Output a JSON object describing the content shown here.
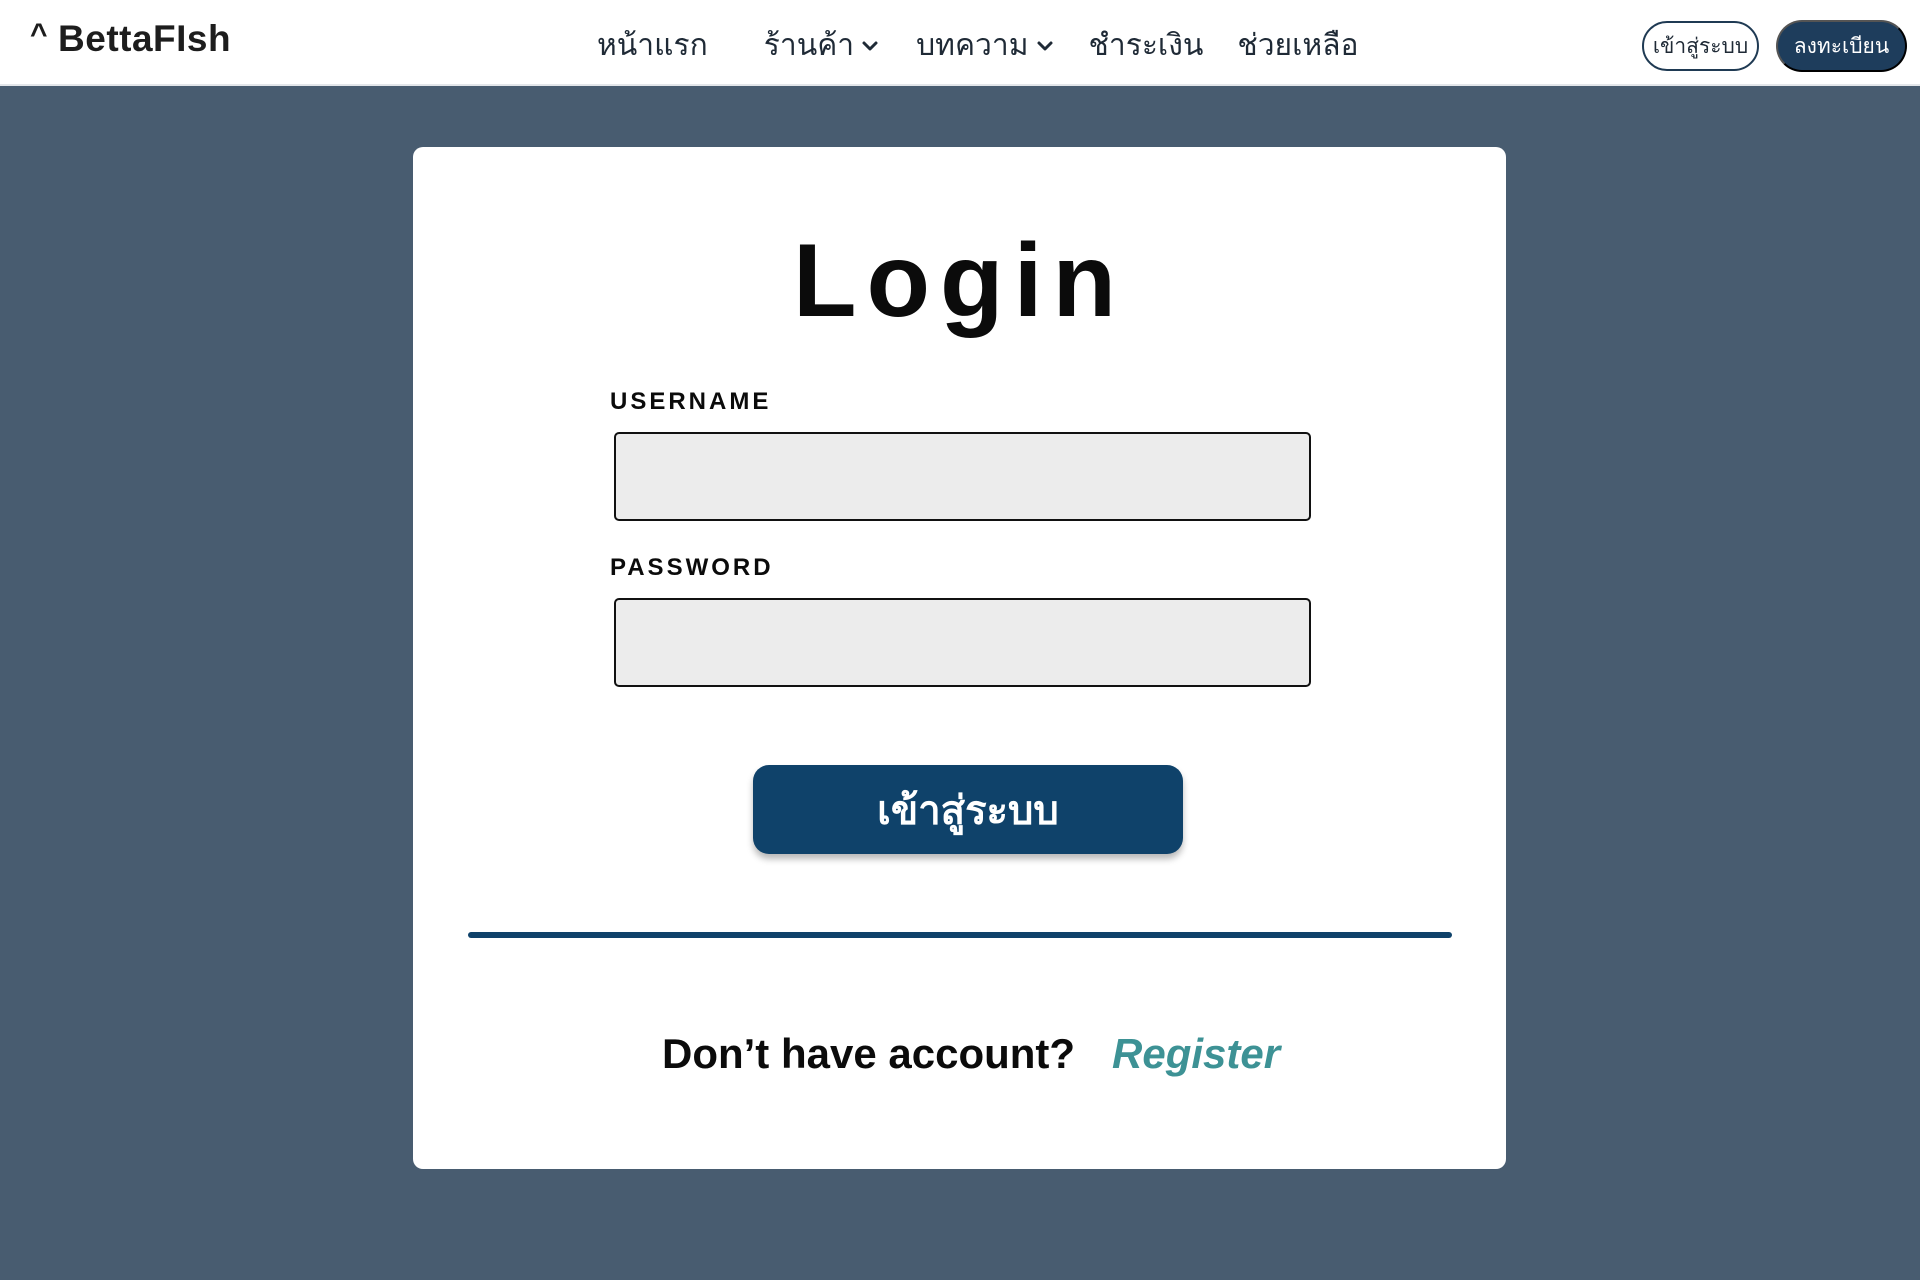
{
  "brand": {
    "caret": "^",
    "name": "BettaFIsh"
  },
  "nav": {
    "items": [
      {
        "label": "หน้าแรก",
        "has_dropdown": false
      },
      {
        "label": "ร้านค้า",
        "has_dropdown": true
      },
      {
        "label": "บทความ",
        "has_dropdown": true
      },
      {
        "label": "ชำระเงิน",
        "has_dropdown": false
      },
      {
        "label": "ช่วยเหลือ",
        "has_dropdown": false
      }
    ],
    "login_label": "เข้าสู่ระบบ",
    "register_label": "ลงทะเบียน"
  },
  "login_card": {
    "title": "Login",
    "username_label": "USERNAME",
    "username_value": "",
    "password_label": "PASSWORD",
    "password_value": "",
    "submit_label": "เข้าสู่ระบบ",
    "no_account_text": "Don’t have account?",
    "register_link": "Register"
  },
  "colors": {
    "page_background": "#485c70",
    "primary": "#0f426a",
    "link": "#3d9295",
    "input_fill": "#ececec"
  },
  "icons": {
    "dropdown": "chevron-down-icon"
  }
}
